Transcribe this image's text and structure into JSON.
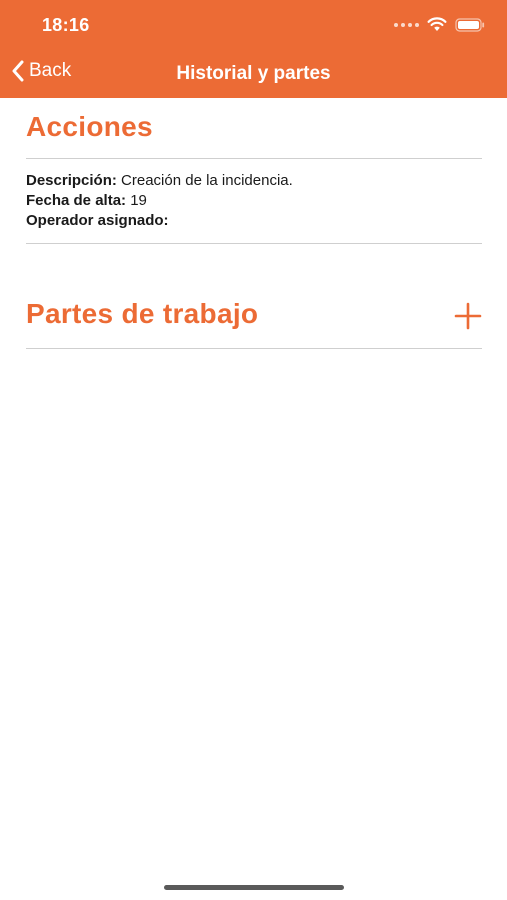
{
  "status_bar": {
    "time": "18:16",
    "icons": [
      "signal-dots-icon",
      "wifi-icon",
      "battery-icon"
    ]
  },
  "nav": {
    "back_label": "Back",
    "title": "Historial y partes",
    "bar_color": "#EC6B35"
  },
  "acciones": {
    "title": "Acciones",
    "descripcion_label": "Descripción:",
    "descripcion_value": "Creación de la incidencia.",
    "fecha_label": "Fecha de alta:",
    "fecha_value": "19",
    "operador_label": "Operador asignado:",
    "operador_value": ""
  },
  "partes": {
    "title": "Partes de trabajo",
    "add_icon": "plus-icon"
  },
  "accent_color": "#EC6B35"
}
